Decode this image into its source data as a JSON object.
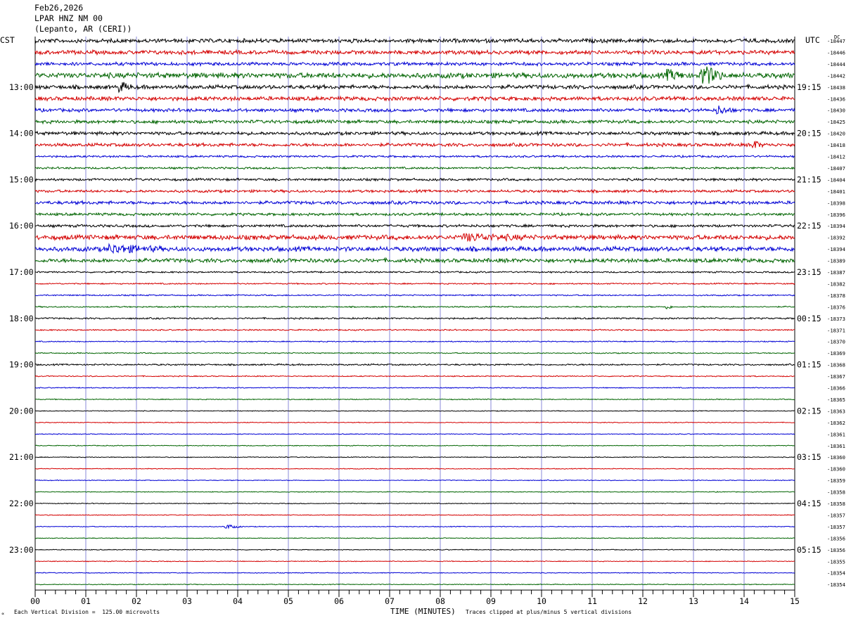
{
  "header": {
    "date": "Feb26,2026",
    "station": "LPAR HNZ NM 00",
    "location": "(Lepanto, AR (CERI))"
  },
  "left_zone_label": "CST",
  "right_zone_label": "UTC",
  "dc_label": "DC",
  "footer": {
    "scale_note": "Each Vertical Division =  125.00 microvolts",
    "xlabel": "TIME (MINUTES)",
    "clip_note": "Traces clipped at plus/minus 5 vertical divisions",
    "corner_mark": "∝"
  },
  "colors": {
    "trace_cycle": [
      "#000000",
      "#d40000",
      "#0000d4",
      "#006400"
    ],
    "grid": "#8a8ad8"
  },
  "chart_data": {
    "type": "helicorder",
    "xlabel": "TIME (MINUTES)",
    "xlim": [
      0,
      15
    ],
    "x_ticks": [
      "00",
      "01",
      "02",
      "03",
      "04",
      "05",
      "06",
      "07",
      "08",
      "09",
      "10",
      "11",
      "12",
      "13",
      "14",
      "15"
    ],
    "minutes_per_trace": 15,
    "trace_count": 48,
    "left_hour_labels": [
      "13:00",
      "14:00",
      "15:00",
      "16:00",
      "17:00",
      "18:00",
      "19:00",
      "20:00",
      "21:00",
      "22:00",
      "23:00"
    ],
    "right_hour_labels": [
      "19:15",
      "20:15",
      "21:15",
      "22:15",
      "23:15",
      "00:15",
      "01:15",
      "02:15",
      "03:15",
      "04:15",
      "05:15"
    ],
    "hour_label_first_trace": 4,
    "dc_offsets": [
      "-18447",
      "-18446",
      "-18444",
      "-18442",
      "-18438",
      "-18436",
      "-18430",
      "-18425",
      "-18420",
      "-18418",
      "-18412",
      "-18407",
      "-18404",
      "-18401",
      "-18398",
      "-18396",
      "-18394",
      "-18392",
      "-18394",
      "-18389",
      "-18387",
      "-18382",
      "-18378",
      "-18376",
      "-18373",
      "-18371",
      "-18370",
      "-18369",
      "-18368",
      "-18367",
      "-18366",
      "-18365",
      "-18363",
      "-18362",
      "-18361",
      "-18361",
      "-18360",
      "-18360",
      "-18359",
      "-18358",
      "-18358",
      "-18357",
      "-18357",
      "-18356",
      "-18356",
      "-18355",
      "-18354",
      "-18354"
    ],
    "noise_level": [
      3,
      3,
      2.5,
      4,
      3,
      3,
      2.5,
      2.5,
      2.5,
      2.5,
      1.5,
      1.5,
      1.8,
      2,
      2.5,
      2,
      2,
      3.5,
      3.5,
      3,
      1.2,
      1,
      1,
      1,
      1.2,
      1,
      0.8,
      0.8,
      1.2,
      0.8,
      0.7,
      0.7,
      0.6,
      0.6,
      0.6,
      0.6,
      0.6,
      0.6,
      0.6,
      0.6,
      0.6,
      0.6,
      0.6,
      0.6,
      0.6,
      0.6,
      0.6,
      0.6
    ],
    "events": [
      {
        "trace": 3,
        "minute": 13.2,
        "amplitude": 14,
        "duration_min": 0.4
      },
      {
        "trace": 3,
        "minute": 12.5,
        "amplitude": 6,
        "duration_min": 0.4
      },
      {
        "trace": 4,
        "minute": 1.7,
        "amplitude": 6,
        "duration_min": 0.2
      },
      {
        "trace": 42,
        "minute": 3.8,
        "amplitude": 3,
        "duration_min": 0.3
      },
      {
        "trace": 23,
        "minute": 12.5,
        "amplitude": 3,
        "duration_min": 0.1
      },
      {
        "trace": 6,
        "minute": 13.5,
        "amplitude": 5,
        "duration_min": 0.3
      },
      {
        "trace": 9,
        "minute": 14.2,
        "amplitude": 5,
        "duration_min": 0.2
      },
      {
        "trace": 18,
        "minute": 1.5,
        "amplitude": 5,
        "duration_min": 1.0
      },
      {
        "trace": 17,
        "minute": 8.5,
        "amplitude": 4,
        "duration_min": 1.2
      }
    ]
  }
}
